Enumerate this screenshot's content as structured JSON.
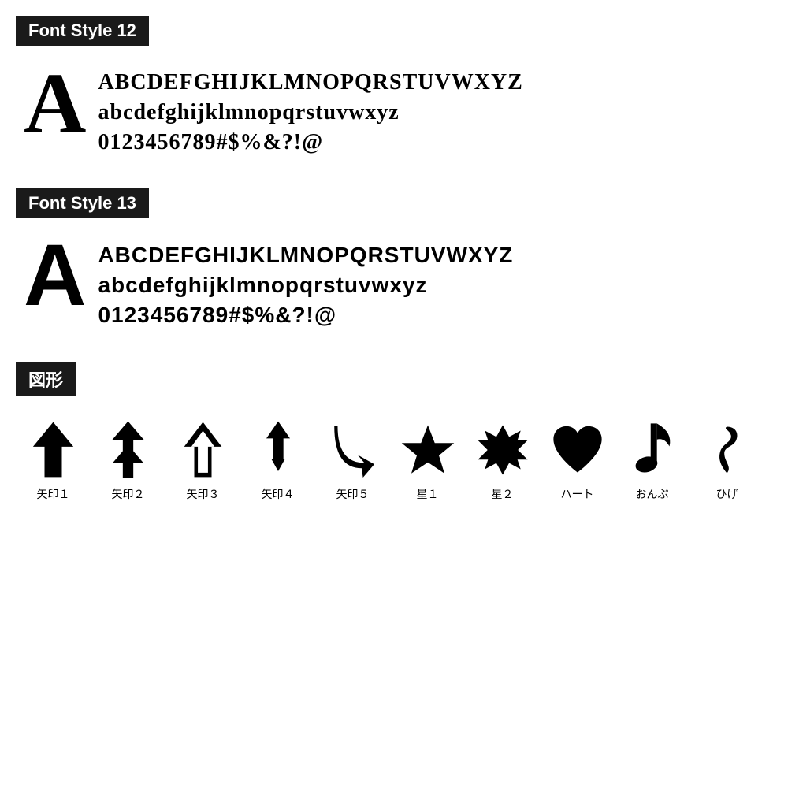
{
  "fontStyle12": {
    "label": "Font Style 12",
    "bigLetter": "A",
    "lines": [
      "ABCDEFGHIJKLMNOPQRSTUVWXYZ",
      "abcdefghijklmnopqrstuvwxyz",
      "0123456789#$%&?!@"
    ]
  },
  "fontStyle13": {
    "label": "Font Style 13",
    "bigLetter": "A",
    "lines": [
      "ABCDEFGHIJKLMNOPQRSTUVWXYZ",
      "abcdefghijklmnopqrstuvwxyz",
      "0123456789#$%&?!@"
    ]
  },
  "shapesSection": {
    "label": "図形",
    "shapes": [
      {
        "id": "yajirushi1",
        "label": "矢印１"
      },
      {
        "id": "yajirushi2",
        "label": "矢印２"
      },
      {
        "id": "yajirushi3",
        "label": "矢印３"
      },
      {
        "id": "yajirushi4",
        "label": "矢印４"
      },
      {
        "id": "yajirushi5",
        "label": "矢印５"
      },
      {
        "id": "hoshi1",
        "label": "星１"
      },
      {
        "id": "hoshi2",
        "label": "星２"
      },
      {
        "id": "heart",
        "label": "ハート"
      },
      {
        "id": "onpu",
        "label": "おんぷ"
      },
      {
        "id": "hige",
        "label": "ひげ"
      }
    ]
  }
}
